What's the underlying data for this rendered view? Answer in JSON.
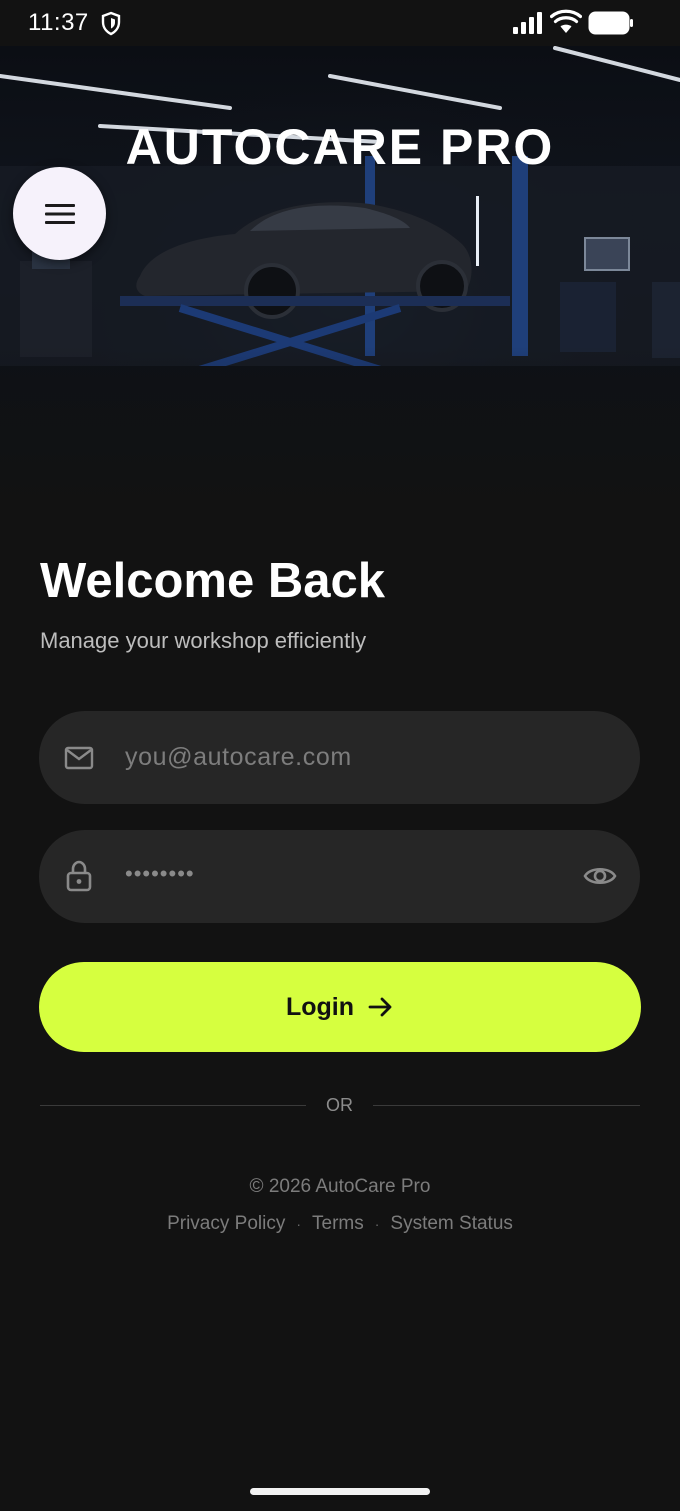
{
  "status_bar": {
    "time": "11:37",
    "icons": [
      "shield-icon",
      "signal-icon",
      "wifi-icon",
      "battery-icon"
    ]
  },
  "header": {
    "app_title": "AUTOCARE PRO",
    "menu_icon": "menu-icon"
  },
  "login": {
    "title": "Welcome Back",
    "subtitle": "Manage your workshop efficiently",
    "email": {
      "placeholder": "you@autocare.com",
      "value": "",
      "icon": "mail-icon"
    },
    "password": {
      "masked_value": "••••••••",
      "icon": "lock-icon",
      "toggle_icon": "eye-icon"
    },
    "submit_label": "Login",
    "submit_icon": "arrow-right-icon",
    "divider_text": "OR"
  },
  "footer": {
    "copyright": "© 2026 AutoCare Pro",
    "links": [
      "Privacy Policy",
      "Terms",
      "System Status"
    ],
    "separator": "·"
  },
  "colors": {
    "background": "#121212",
    "field_background": "#262626",
    "accent": "#d6ff3f",
    "menu_button": "#f6f2fb"
  }
}
